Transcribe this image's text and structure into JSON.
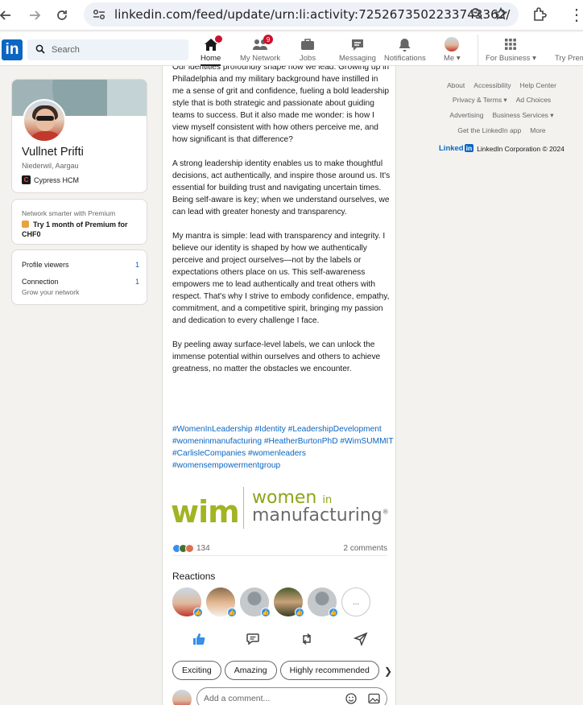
{
  "browser": {
    "url": "linkedin.com/feed/update/urn:li:activity:7252673502233743362/"
  },
  "linkedin_header": {
    "search_placeholder": "Search",
    "nav": [
      {
        "label": "Home",
        "icon": "home-icon",
        "badge": ""
      },
      {
        "label": "My Network",
        "icon": "network-icon",
        "badge": "9"
      },
      {
        "label": "Jobs",
        "icon": "briefcase-icon",
        "badge": ""
      },
      {
        "label": "Messaging",
        "icon": "chat-icon",
        "badge": ""
      },
      {
        "label": "Notifications",
        "icon": "bell-icon",
        "badge": ""
      },
      {
        "label": "Me",
        "icon": "avatar-icon",
        "badge": ""
      },
      {
        "label": "For Business",
        "icon": "grid-icon",
        "badge": ""
      },
      {
        "label": "Try Premium",
        "icon": "premium-icon",
        "badge": ""
      }
    ]
  },
  "profile": {
    "name": "Vullnet Prifti",
    "location": "Niederwil, Aargau",
    "company": "Cypress HCM",
    "premium_promo": "Network smarter with Premium",
    "premium_link": "Try 1 month of Premium for CHF0",
    "stats": [
      {
        "label": "Profile viewers",
        "value": "1"
      },
      {
        "label": "Connection",
        "value": "1",
        "sub": "Grow your network"
      }
    ]
  },
  "post": {
    "paragraphs": [
      "Our identities profoundly shape how we lead. Growing up in Philadelphia and my military background have instilled in me a sense of grit and confidence, fueling a bold leadership style that is both strategic and passionate about guiding teams to success. But it also made me wonder: is how I view myself consistent with how others perceive me, and how significant is that difference?",
      "A strong leadership identity enables us to make thoughtful decisions, act authentically, and inspire those around us. It's essential for building trust and navigating uncertain times. Being self-aware is key; when we understand ourselves, we can lead with greater honesty and transparency.",
      "My mantra is simple: lead with transparency and integrity. I believe our identity is shaped by how we authentically perceive and project ourselves—not by the labels or expectations others place on us. This self-awareness empowers me to lead authentically and treat others with respect. That's why I strive to embody confidence, empathy, commitment, and a competitive spirit, bringing my passion and dedication to every challenge I face.",
      "By peeling away surface-level labels, we can unlock the immense potential within ourselves and others to achieve greatness, no matter the obstacles we encounter."
    ],
    "hashtags": "#WomenInLeadership #Identity #LeadershipDevelopment #womeninmanufacturing #HeatherBurtonPhD #WimSUMMIT #CarlisleCompanies #womenleaders #womensempowermentgroup",
    "image": {
      "logo_mark": "wim",
      "line1": "women",
      "line1_small": "in",
      "line2": "manufacturing",
      "reg": "®"
    },
    "reaction_count": "134",
    "comments_count": "2 comments",
    "reactions_heading": "Reactions",
    "more_reactors": "...",
    "chips": [
      "Exciting",
      "Amazing",
      "Highly recommended"
    ],
    "comment_placeholder": "Add a comment..."
  },
  "footer": {
    "row1": [
      "About",
      "Accessibility",
      "Help Center"
    ],
    "row2": [
      "Privacy & Terms ▾",
      "Ad Choices"
    ],
    "row3": [
      "Advertising",
      "Business Services ▾"
    ],
    "row4": [
      "Get the LinkedIn app",
      "More"
    ],
    "brand": "Linked",
    "brand_in": "in",
    "copyright": "LinkedIn Corporation © 2024"
  }
}
